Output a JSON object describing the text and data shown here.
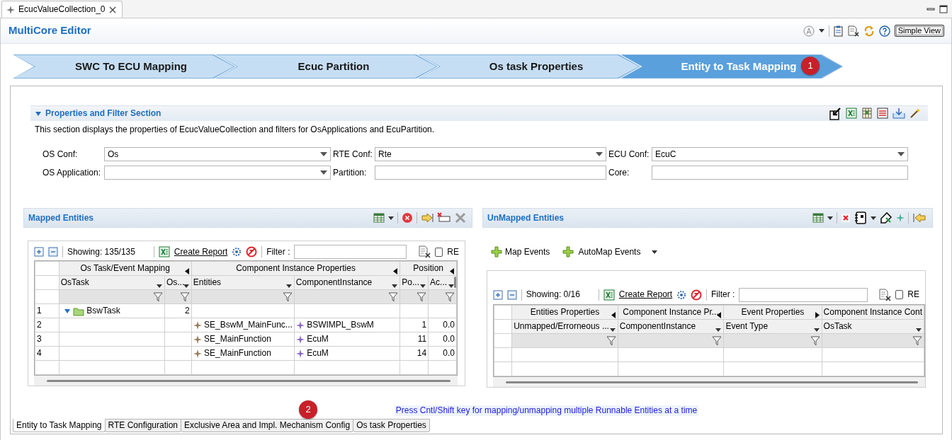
{
  "editor_tab": {
    "title": "EcucValueCollection_0"
  },
  "header": {
    "title": "MultiCore Editor",
    "view_button": "Simple View"
  },
  "steps": [
    {
      "label": "SWC To ECU Mapping",
      "selected": false
    },
    {
      "label": "Ecuc Partition",
      "selected": false
    },
    {
      "label": "Os task Properties",
      "selected": false
    },
    {
      "label": "Entity to Task Mapping",
      "selected": true,
      "badge": "1"
    }
  ],
  "properties_section": {
    "title": "Properties and Filter Section",
    "expanded": true,
    "description": "This section displays the properties of EcucValueCollection and filters for OsApplications and EcuPartition.",
    "fields": [
      {
        "label": "OS Conf:",
        "kind": "combo",
        "value": "Os"
      },
      {
        "label": "RTE Conf:",
        "kind": "combo",
        "value": "Rte"
      },
      {
        "label": "ECU Conf:",
        "kind": "combo",
        "value": "EcuC"
      },
      {
        "label": "OS Application:",
        "kind": "combo"
      },
      {
        "label": "Partition:",
        "kind": "text"
      },
      {
        "label": "Core:",
        "kind": "text"
      }
    ]
  },
  "mapped_entities": {
    "title": "Mapped Entities",
    "toolbar": {
      "showing": "Showing: 135/135",
      "report_link": "Create Report",
      "filter_label": "Filter :",
      "re_label": "RE",
      "re_checked": false
    },
    "column_groups": [
      {
        "label": "Os Task/Event Mapping",
        "expanded": true,
        "columns": [
          {
            "label": "OsTask",
            "kind": "text"
          },
          {
            "label": "Os...",
            "kind": "number"
          }
        ]
      },
      {
        "label": "Component Instance Properties",
        "expanded": true,
        "columns": [
          {
            "label": "Entities",
            "kind": "text"
          },
          {
            "label": "ComponentInstance",
            "kind": "text"
          }
        ]
      },
      {
        "label": "Position",
        "expanded": true,
        "columns": [
          {
            "label": "Po...",
            "kind": "number"
          },
          {
            "label": "Ac...",
            "kind": "number"
          }
        ]
      }
    ],
    "rows": [
      {
        "number": "1",
        "kind": "task",
        "expanded": true,
        "cells": [
          "BswTask",
          "2",
          null,
          null,
          null,
          null
        ]
      },
      {
        "number": "2",
        "kind": "entity",
        "cells": [
          null,
          null,
          "SE_BswM_MainFunc...",
          "BSWIMPL_BswM",
          "1",
          "0.0"
        ]
      },
      {
        "number": "3",
        "kind": "entity",
        "cells": [
          null,
          null,
          "SE_MainFunction",
          "EcuM",
          "11",
          "0.0"
        ]
      },
      {
        "number": "4",
        "kind": "entity",
        "cells": [
          null,
          null,
          "SE_MainFunction",
          "EcuM",
          "14",
          "0.0"
        ]
      }
    ]
  },
  "unmapped_entities": {
    "title": "UnMapped Entities",
    "actions": [
      {
        "label": "Map Events",
        "kind": "link"
      },
      {
        "label": "AutoMap Events",
        "kind": "menu"
      }
    ],
    "toolbar": {
      "showing": "Showing: 0/16",
      "report_link": "Create Report",
      "filter_label": "Filter :",
      "re_label": "RE",
      "re_checked": false
    },
    "column_groups": [
      {
        "label": "Entities Properties",
        "expanded": true,
        "columns": [
          "Unmapped/Errorneous ..."
        ]
      },
      {
        "label": "Component Instance Pr...",
        "expanded": true,
        "columns": [
          "ComponentInstance"
        ]
      },
      {
        "label": "Event Properties",
        "expanded": false,
        "columns": [
          "Event Type"
        ]
      },
      {
        "label": "Component Instance Cont",
        "columns": [
          "OsTask"
        ]
      }
    ]
  },
  "hint": "Press Cntl/Shift key for mapping/unmapping multiple Runnable Entities at a time",
  "bottom_tabs": [
    {
      "label": "Entity to Task Mapping",
      "selected": true
    },
    {
      "label": "RTE Configuration",
      "selected": false
    },
    {
      "label": "Exclusive Area and Impl. Mechanism Config",
      "selected": false,
      "badge": "2"
    },
    {
      "label": "Os task Properties",
      "selected": false
    }
  ]
}
